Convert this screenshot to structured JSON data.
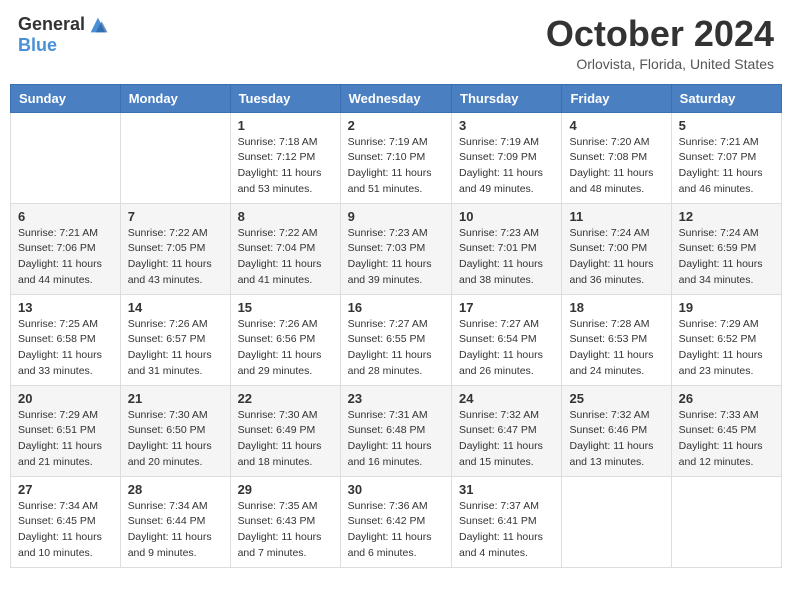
{
  "header": {
    "logo_general": "General",
    "logo_blue": "Blue",
    "month_title": "October 2024",
    "location": "Orlovista, Florida, United States"
  },
  "weekdays": [
    "Sunday",
    "Monday",
    "Tuesday",
    "Wednesday",
    "Thursday",
    "Friday",
    "Saturday"
  ],
  "weeks": [
    [
      {
        "day": "",
        "sunrise": "",
        "sunset": "",
        "daylight": ""
      },
      {
        "day": "",
        "sunrise": "",
        "sunset": "",
        "daylight": ""
      },
      {
        "day": "1",
        "sunrise": "Sunrise: 7:18 AM",
        "sunset": "Sunset: 7:12 PM",
        "daylight": "Daylight: 11 hours and 53 minutes."
      },
      {
        "day": "2",
        "sunrise": "Sunrise: 7:19 AM",
        "sunset": "Sunset: 7:10 PM",
        "daylight": "Daylight: 11 hours and 51 minutes."
      },
      {
        "day": "3",
        "sunrise": "Sunrise: 7:19 AM",
        "sunset": "Sunset: 7:09 PM",
        "daylight": "Daylight: 11 hours and 49 minutes."
      },
      {
        "day": "4",
        "sunrise": "Sunrise: 7:20 AM",
        "sunset": "Sunset: 7:08 PM",
        "daylight": "Daylight: 11 hours and 48 minutes."
      },
      {
        "day": "5",
        "sunrise": "Sunrise: 7:21 AM",
        "sunset": "Sunset: 7:07 PM",
        "daylight": "Daylight: 11 hours and 46 minutes."
      }
    ],
    [
      {
        "day": "6",
        "sunrise": "Sunrise: 7:21 AM",
        "sunset": "Sunset: 7:06 PM",
        "daylight": "Daylight: 11 hours and 44 minutes."
      },
      {
        "day": "7",
        "sunrise": "Sunrise: 7:22 AM",
        "sunset": "Sunset: 7:05 PM",
        "daylight": "Daylight: 11 hours and 43 minutes."
      },
      {
        "day": "8",
        "sunrise": "Sunrise: 7:22 AM",
        "sunset": "Sunset: 7:04 PM",
        "daylight": "Daylight: 11 hours and 41 minutes."
      },
      {
        "day": "9",
        "sunrise": "Sunrise: 7:23 AM",
        "sunset": "Sunset: 7:03 PM",
        "daylight": "Daylight: 11 hours and 39 minutes."
      },
      {
        "day": "10",
        "sunrise": "Sunrise: 7:23 AM",
        "sunset": "Sunset: 7:01 PM",
        "daylight": "Daylight: 11 hours and 38 minutes."
      },
      {
        "day": "11",
        "sunrise": "Sunrise: 7:24 AM",
        "sunset": "Sunset: 7:00 PM",
        "daylight": "Daylight: 11 hours and 36 minutes."
      },
      {
        "day": "12",
        "sunrise": "Sunrise: 7:24 AM",
        "sunset": "Sunset: 6:59 PM",
        "daylight": "Daylight: 11 hours and 34 minutes."
      }
    ],
    [
      {
        "day": "13",
        "sunrise": "Sunrise: 7:25 AM",
        "sunset": "Sunset: 6:58 PM",
        "daylight": "Daylight: 11 hours and 33 minutes."
      },
      {
        "day": "14",
        "sunrise": "Sunrise: 7:26 AM",
        "sunset": "Sunset: 6:57 PM",
        "daylight": "Daylight: 11 hours and 31 minutes."
      },
      {
        "day": "15",
        "sunrise": "Sunrise: 7:26 AM",
        "sunset": "Sunset: 6:56 PM",
        "daylight": "Daylight: 11 hours and 29 minutes."
      },
      {
        "day": "16",
        "sunrise": "Sunrise: 7:27 AM",
        "sunset": "Sunset: 6:55 PM",
        "daylight": "Daylight: 11 hours and 28 minutes."
      },
      {
        "day": "17",
        "sunrise": "Sunrise: 7:27 AM",
        "sunset": "Sunset: 6:54 PM",
        "daylight": "Daylight: 11 hours and 26 minutes."
      },
      {
        "day": "18",
        "sunrise": "Sunrise: 7:28 AM",
        "sunset": "Sunset: 6:53 PM",
        "daylight": "Daylight: 11 hours and 24 minutes."
      },
      {
        "day": "19",
        "sunrise": "Sunrise: 7:29 AM",
        "sunset": "Sunset: 6:52 PM",
        "daylight": "Daylight: 11 hours and 23 minutes."
      }
    ],
    [
      {
        "day": "20",
        "sunrise": "Sunrise: 7:29 AM",
        "sunset": "Sunset: 6:51 PM",
        "daylight": "Daylight: 11 hours and 21 minutes."
      },
      {
        "day": "21",
        "sunrise": "Sunrise: 7:30 AM",
        "sunset": "Sunset: 6:50 PM",
        "daylight": "Daylight: 11 hours and 20 minutes."
      },
      {
        "day": "22",
        "sunrise": "Sunrise: 7:30 AM",
        "sunset": "Sunset: 6:49 PM",
        "daylight": "Daylight: 11 hours and 18 minutes."
      },
      {
        "day": "23",
        "sunrise": "Sunrise: 7:31 AM",
        "sunset": "Sunset: 6:48 PM",
        "daylight": "Daylight: 11 hours and 16 minutes."
      },
      {
        "day": "24",
        "sunrise": "Sunrise: 7:32 AM",
        "sunset": "Sunset: 6:47 PM",
        "daylight": "Daylight: 11 hours and 15 minutes."
      },
      {
        "day": "25",
        "sunrise": "Sunrise: 7:32 AM",
        "sunset": "Sunset: 6:46 PM",
        "daylight": "Daylight: 11 hours and 13 minutes."
      },
      {
        "day": "26",
        "sunrise": "Sunrise: 7:33 AM",
        "sunset": "Sunset: 6:45 PM",
        "daylight": "Daylight: 11 hours and 12 minutes."
      }
    ],
    [
      {
        "day": "27",
        "sunrise": "Sunrise: 7:34 AM",
        "sunset": "Sunset: 6:45 PM",
        "daylight": "Daylight: 11 hours and 10 minutes."
      },
      {
        "day": "28",
        "sunrise": "Sunrise: 7:34 AM",
        "sunset": "Sunset: 6:44 PM",
        "daylight": "Daylight: 11 hours and 9 minutes."
      },
      {
        "day": "29",
        "sunrise": "Sunrise: 7:35 AM",
        "sunset": "Sunset: 6:43 PM",
        "daylight": "Daylight: 11 hours and 7 minutes."
      },
      {
        "day": "30",
        "sunrise": "Sunrise: 7:36 AM",
        "sunset": "Sunset: 6:42 PM",
        "daylight": "Daylight: 11 hours and 6 minutes."
      },
      {
        "day": "31",
        "sunrise": "Sunrise: 7:37 AM",
        "sunset": "Sunset: 6:41 PM",
        "daylight": "Daylight: 11 hours and 4 minutes."
      },
      {
        "day": "",
        "sunrise": "",
        "sunset": "",
        "daylight": ""
      },
      {
        "day": "",
        "sunrise": "",
        "sunset": "",
        "daylight": ""
      }
    ]
  ]
}
